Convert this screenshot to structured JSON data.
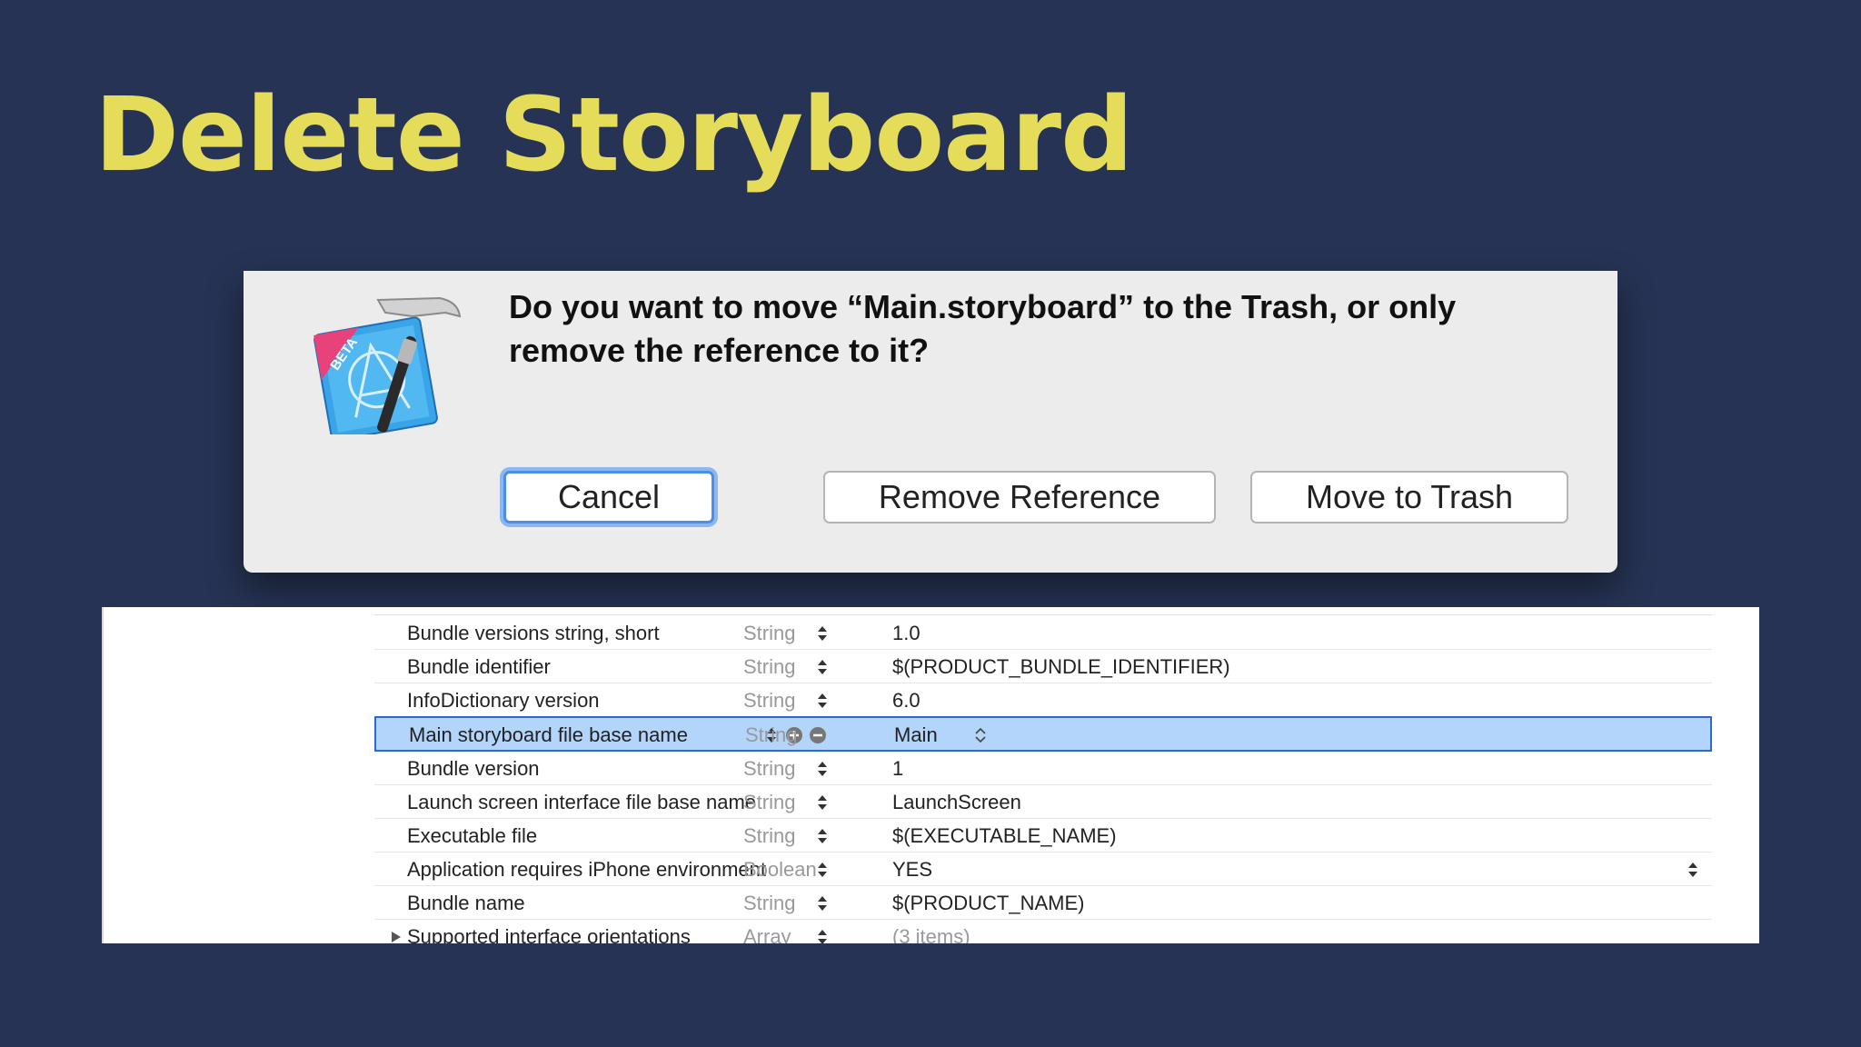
{
  "slide": {
    "title": "Delete Storyboard",
    "title_color": "#e5dd5a",
    "background": "#263354"
  },
  "dialog": {
    "icon": "xcode-beta-icon",
    "message": "Do you want to move “Main.storyboard” to the Trash, or only remove the reference to it?",
    "buttons": {
      "cancel": "Cancel",
      "remove_reference": "Remove Reference",
      "move_to_trash": "Move to Trash"
    },
    "focused_button": "cancel",
    "focus_color": "#4a8ee8"
  },
  "plist": {
    "rows": [
      {
        "key": "Bundle versions string, short",
        "type": "String",
        "value": "1.0"
      },
      {
        "key": "Bundle identifier",
        "type": "String",
        "value": "$(PRODUCT_BUNDLE_IDENTIFIER)"
      },
      {
        "key": "InfoDictionary version",
        "type": "String",
        "value": "6.0"
      },
      {
        "key": "Main storyboard file base name",
        "type": "String",
        "value": "Main",
        "selected": true
      },
      {
        "key": "Bundle version",
        "type": "String",
        "value": "1"
      },
      {
        "key": "Launch screen interface file base name",
        "type": "String",
        "value": "LaunchScreen"
      },
      {
        "key": "Executable file",
        "type": "String",
        "value": "$(EXECUTABLE_NAME)"
      },
      {
        "key": "Application requires iPhone environment",
        "type": "Boolean",
        "value": "YES"
      },
      {
        "key": "Bundle name",
        "type": "String",
        "value": "$(PRODUCT_NAME)"
      },
      {
        "key": "Supported interface orientations",
        "type": "Array",
        "value": "(3 items)",
        "collapsed": true
      }
    ],
    "selection_color": "#b3d4fb"
  }
}
